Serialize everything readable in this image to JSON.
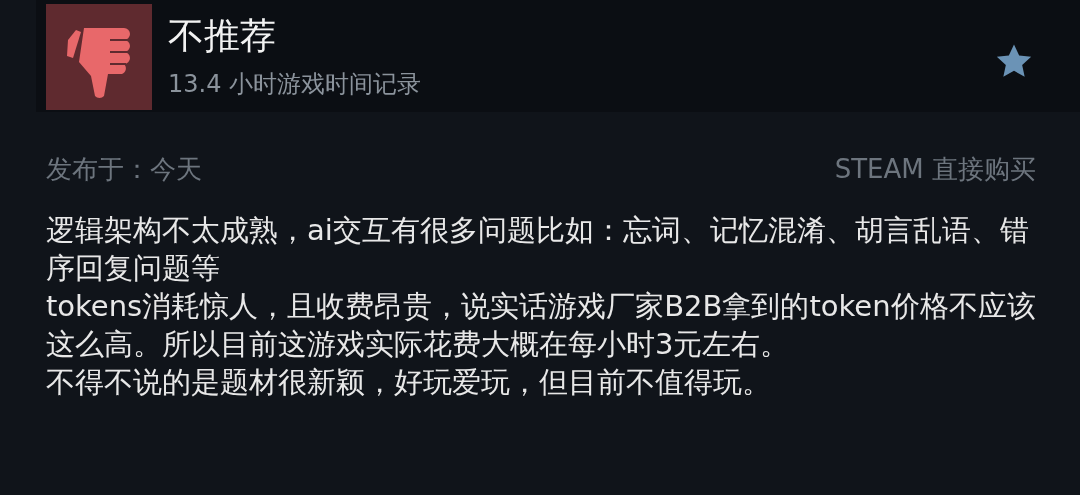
{
  "review": {
    "recommended": false,
    "verdict": "不推荐",
    "hours": "13.4 小时游戏时间记录"
  },
  "posted": "发布于：今天",
  "source": "STEAM 直接购买",
  "paragraphs": [
    "逻辑架构不太成熟，ai交互有很多问题比如：忘词、记忆混淆、胡言乱语、错序回复问题等",
    "tokens消耗惊人，且收费昂贵，说实话游戏厂家B2B拿到的token价格不应该这么高。所以目前这游戏实际花费大概在每小时3元左右。",
    "不得不说的是题材很新颖，好玩爱玩，但目前不值得玩。"
  ]
}
